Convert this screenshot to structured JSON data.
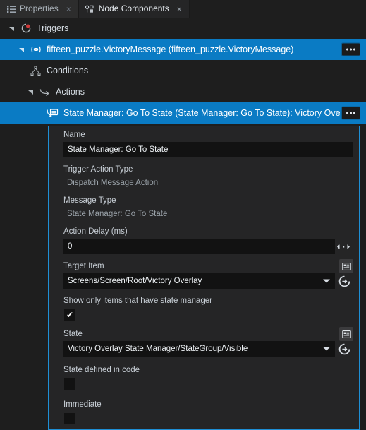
{
  "tabs": [
    {
      "label": "Properties",
      "icon": "list-icon",
      "active": false,
      "close": "×"
    },
    {
      "label": "Node Components",
      "icon": "node-components-icon",
      "active": true,
      "close": "×"
    }
  ],
  "tree": [
    {
      "label": "Triggers",
      "icon": "triggers-icon",
      "selected": false,
      "indent": 0,
      "twisty": "expanded",
      "menu": false
    },
    {
      "label": "fifteen_puzzle.VictoryMessage (fifteen_puzzle.VictoryMessage)",
      "icon": "message-icon",
      "selected": true,
      "indent": 1,
      "twisty": "expanded",
      "menu": true
    },
    {
      "label": "Conditions",
      "icon": "conditions-icon",
      "selected": false,
      "indent": 2,
      "twisty": "none",
      "menu": false
    },
    {
      "label": "Actions",
      "icon": "actions-icon",
      "selected": false,
      "indent": 2,
      "twisty": "expanded",
      "menu": false
    },
    {
      "label": "State Manager: Go To State (State Manager: Go To State): Victory Overlay",
      "icon": "state-manager-icon",
      "selected": true,
      "indent": 3,
      "twisty": "none",
      "menu": true
    }
  ],
  "details": {
    "name": {
      "label": "Name",
      "value": "State Manager: Go To State"
    },
    "trigger_action_type": {
      "label": "Trigger Action Type",
      "value": "Dispatch Message Action"
    },
    "message_type": {
      "label": "Message Type",
      "value": "State Manager: Go To State"
    },
    "action_delay": {
      "label": "Action Delay (ms)",
      "value": "0"
    },
    "target_item": {
      "label": "Target Item",
      "value": "Screens/Screen/Root/Victory Overlay",
      "picker_icon": "picker-icon",
      "reset_icon": "reset-icon"
    },
    "show_only_state_manager": {
      "label": "Show only items that have state manager",
      "checked": true,
      "check_glyph": "✔"
    },
    "state": {
      "label": "State",
      "value": "Victory Overlay State Manager/StateGroup/Visible",
      "picker_icon": "picker-icon",
      "reset_icon": "reset-icon"
    },
    "state_defined_in_code": {
      "label": "State defined in code",
      "checked": false,
      "check_glyph": ""
    },
    "immediate": {
      "label": "Immediate",
      "checked": false,
      "check_glyph": ""
    }
  },
  "colors": {
    "selection_blue": "#0a7bc4",
    "border_blue": "#1e8fd5",
    "panel_bg": "#252526",
    "window_bg": "#1e1e1e",
    "input_bg": "#121212",
    "label_text": "#c8cfd6",
    "dim_text": "#8d959c"
  }
}
